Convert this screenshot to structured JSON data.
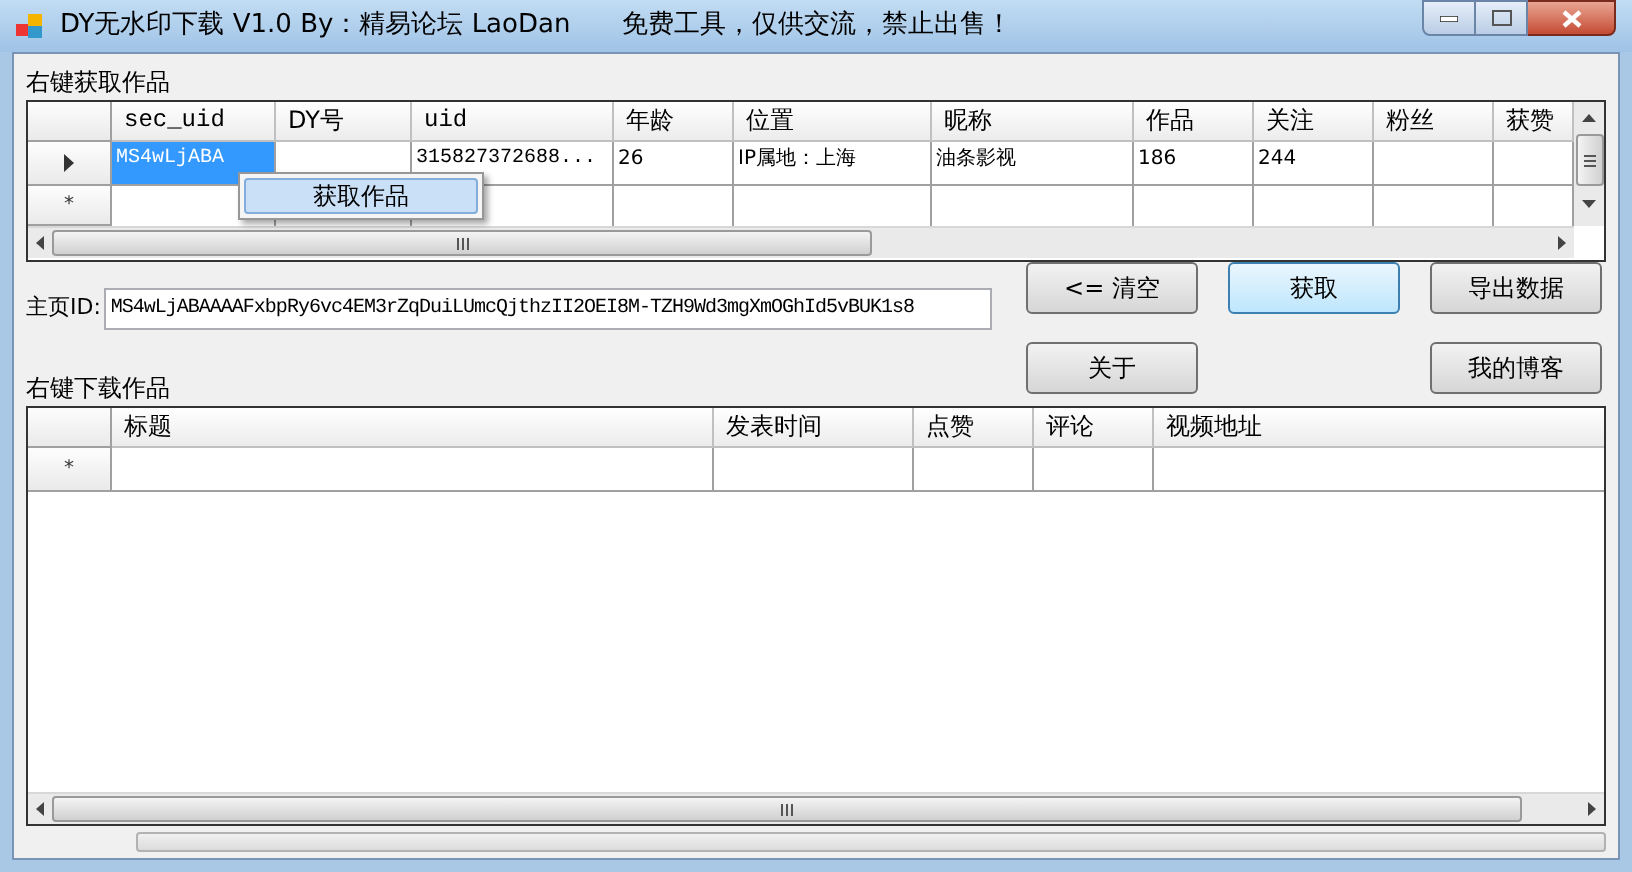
{
  "window": {
    "title": "DY无水印下载 V1.0 By：精易论坛 LaoDan　　免费工具，仅供交流，禁止出售！"
  },
  "top_group": {
    "label": "右键获取作品",
    "columns": [
      {
        "label": "sec_uid",
        "mono": true
      },
      {
        "label": "DY号",
        "mono": false
      },
      {
        "label": "uid",
        "mono": true
      },
      {
        "label": "年龄",
        "mono": false
      },
      {
        "label": "位置",
        "mono": false
      },
      {
        "label": "昵称",
        "mono": false
      },
      {
        "label": "作品",
        "mono": false
      },
      {
        "label": "关注",
        "mono": false
      },
      {
        "label": "粉丝",
        "mono": false
      },
      {
        "label": "获赞",
        "mono": false
      }
    ],
    "rows": [
      {
        "current": true,
        "cells": [
          {
            "text": "MS4wLjABA",
            "selected": true
          },
          {
            "text": "",
            "selected": false
          },
          {
            "text": "315827372688...",
            "selected": false
          },
          {
            "text": "26",
            "selected": false
          },
          {
            "text": "IP属地：上海",
            "selected": false
          },
          {
            "text": "油条影视",
            "selected": false
          },
          {
            "text": "186",
            "selected": false
          },
          {
            "text": "244",
            "selected": false
          },
          {
            "text": "",
            "selected": false
          },
          {
            "text": "",
            "selected": false
          }
        ]
      }
    ],
    "new_row_mark": "*"
  },
  "context_menu": {
    "items": [
      "获取作品"
    ]
  },
  "homepage": {
    "label": "主页ID:",
    "value": "MS4wLjABAAAAFxbpRy6vc4EM3rZqDuiLUmcQjthzII2OEI8M-TZH9Wd3mgXmOGhId5vBUK1s8"
  },
  "buttons": [
    {
      "label": "<= 清空",
      "focused": false
    },
    {
      "label": "获取",
      "focused": true
    },
    {
      "label": "导出数据",
      "focused": false
    },
    {
      "label": "关于",
      "focused": false
    },
    {
      "label": "我的博客",
      "focused": false
    }
  ],
  "progress": {
    "level": 0
  },
  "bottom_group": {
    "label": "右键下载作品",
    "columns": [
      "标题",
      "发表时间",
      "点赞",
      "评论",
      "视频地址"
    ],
    "new_row_mark": "*"
  }
}
